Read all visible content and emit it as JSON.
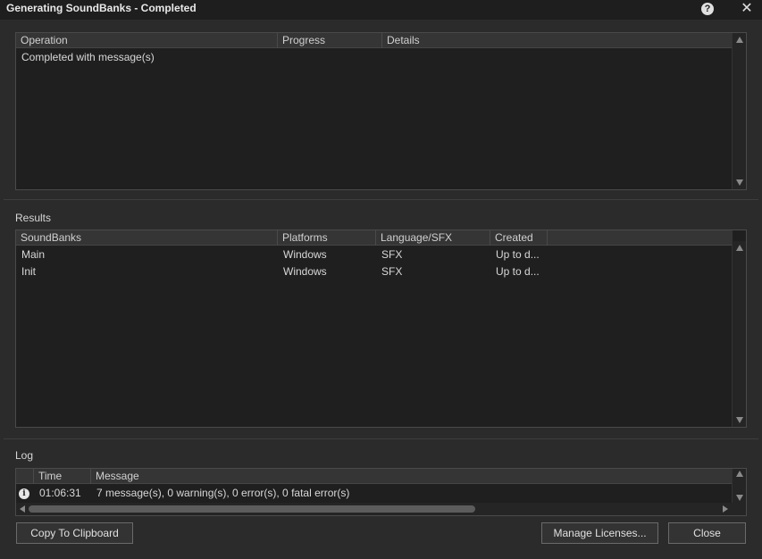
{
  "window": {
    "title": "Generating SoundBanks - Completed",
    "help_glyph": "?",
    "close_glyph": "✕"
  },
  "operations": {
    "columns": [
      "Operation",
      "Progress",
      "Details"
    ],
    "rows": [
      {
        "operation": "Completed with message(s)",
        "progress": "",
        "details": ""
      }
    ]
  },
  "results": {
    "label": "Results",
    "columns": [
      "SoundBanks",
      "Platforms",
      "Language/SFX",
      "Created"
    ],
    "rows": [
      {
        "soundbank": "Main",
        "platform": "Windows",
        "language": "SFX",
        "created": "Up to d..."
      },
      {
        "soundbank": "Init",
        "platform": "Windows",
        "language": "SFX",
        "created": "Up to d..."
      }
    ]
  },
  "log": {
    "label": "Log",
    "columns": [
      "",
      "Time",
      "Message"
    ],
    "rows": [
      {
        "icon": "info-icon",
        "icon_glyph": "i",
        "time": "01:06:31",
        "message": "7 message(s), 0 warning(s), 0 error(s), 0 fatal error(s)"
      }
    ]
  },
  "buttons": {
    "copy": "Copy To Clipboard",
    "manage": "Manage Licenses...",
    "close": "Close"
  },
  "colors": {
    "background": "#2b2b2b",
    "panel": "#1f1f1f",
    "titlebar": "#1e1e1e",
    "header": "#353535"
  }
}
